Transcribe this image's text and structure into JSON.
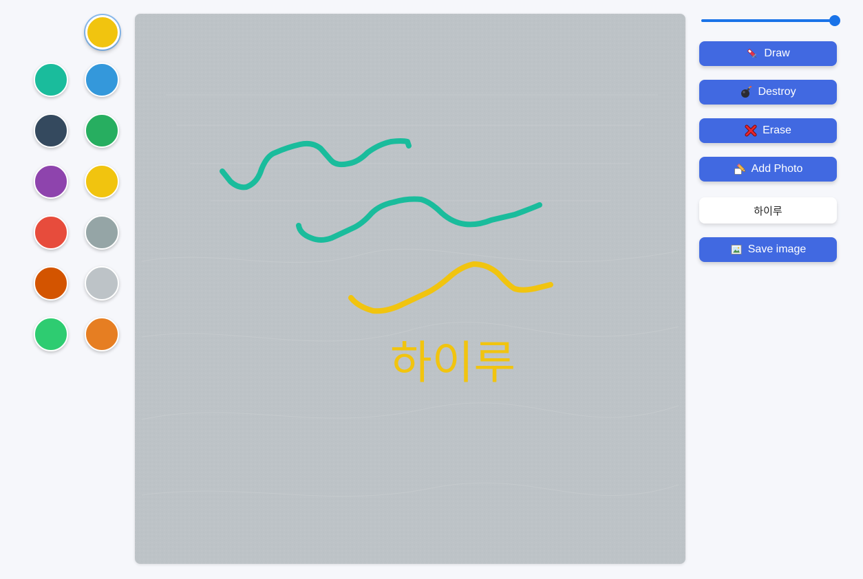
{
  "palette": {
    "selected_color": "#f1c40f",
    "colors": [
      "#f1c40f",
      "#1abc9c",
      "#3498db",
      "#34495e",
      "#27ae60",
      "#8e44ad",
      "#f1c40f",
      "#e74c3c",
      "#95a5a6",
      "#d35400",
      "#bdc3c7",
      "#2ecc71",
      "#e67e22"
    ]
  },
  "canvas": {
    "background": "#bdc3c7",
    "text_label": "하이루",
    "text_color": "#f1c40f",
    "stroke_colors": [
      "#1abc9c",
      "#1abc9c",
      "#f1c40f"
    ]
  },
  "controls": {
    "brush_size": {
      "value": 1.0
    },
    "buttons": {
      "draw": {
        "label": "Draw",
        "icon": "syringe-icon"
      },
      "destroy": {
        "label": "Destroy",
        "icon": "bomb-icon"
      },
      "erase": {
        "label": "Erase",
        "icon": "cross-mark-icon"
      },
      "add_photo": {
        "label": "Add Photo",
        "icon": "pencil-paper-icon"
      },
      "save": {
        "label": "Save image",
        "icon": "framed-picture-icon"
      }
    },
    "text_input": {
      "value": "하이루"
    },
    "accent": "#4169e1"
  }
}
